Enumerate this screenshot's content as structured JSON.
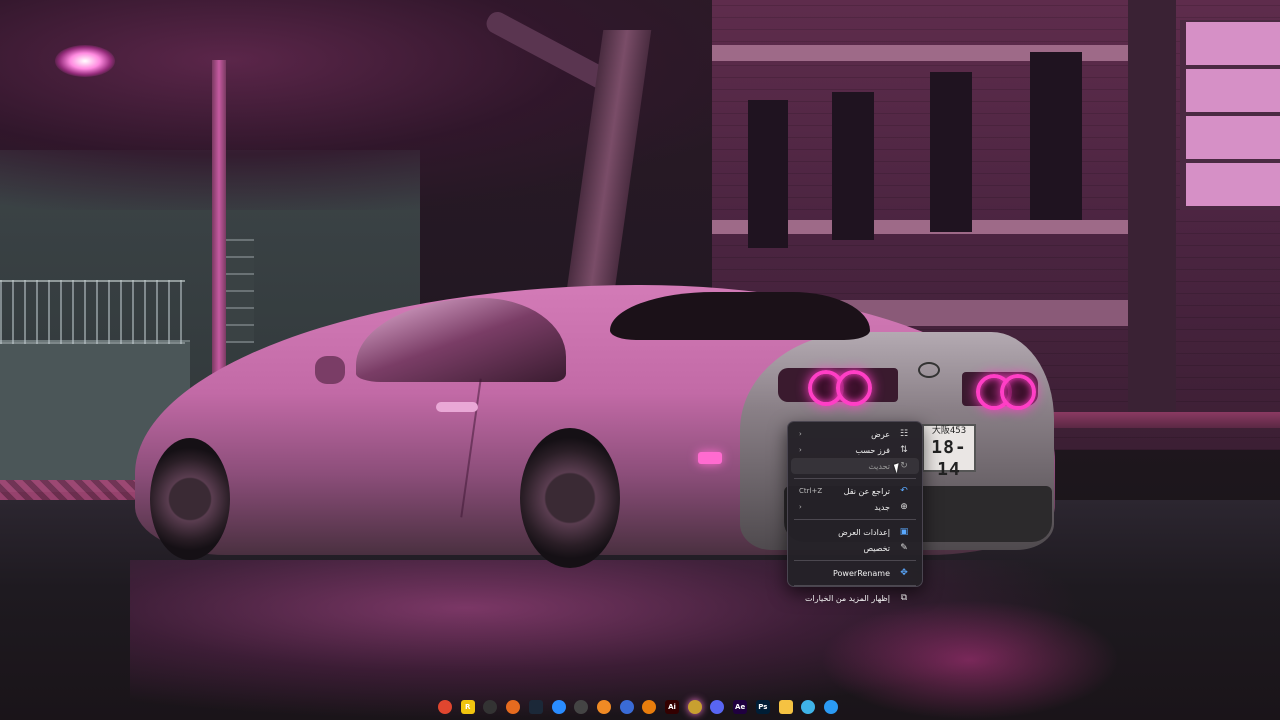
{
  "context_menu": {
    "items": [
      {
        "label": "عرض",
        "icon": "grid-icon",
        "submenu": true,
        "enabled": true
      },
      {
        "label": "فرز حسب",
        "icon": "sort-icon",
        "submenu": true,
        "enabled": true
      },
      {
        "label": "تحديث",
        "icon": "refresh-icon",
        "submenu": false,
        "enabled": false
      },
      {
        "label": "تراجع عن نقل",
        "icon": "undo-icon",
        "shortcut": "Ctrl+Z",
        "enabled": true
      },
      {
        "label": "جديد",
        "icon": "plus-circle-icon",
        "submenu": true,
        "enabled": true
      },
      {
        "label": "إعدادات العرض",
        "icon": "display-icon",
        "enabled": true
      },
      {
        "label": "تخصيص",
        "icon": "brush-icon",
        "enabled": true
      },
      {
        "label": "PowerRename",
        "icon": "powerrename-icon",
        "enabled": true
      },
      {
        "label": "إظهار المزيد من الخيارات",
        "icon": "open-external-icon",
        "enabled": true
      }
    ]
  },
  "wallpaper": {
    "plate_top": "大阪453",
    "plate_bottom": "18-14"
  },
  "taskbar": {
    "icons": [
      {
        "name": "chrome-icon",
        "color": "#e0462f"
      },
      {
        "name": "app-yellow-icon",
        "color": "#f1c40f",
        "text": "R"
      },
      {
        "name": "obs-icon",
        "color": "#333333"
      },
      {
        "name": "firefox-icon",
        "color": "#e56b1f"
      },
      {
        "name": "steam-icon",
        "color": "#1b2838"
      },
      {
        "name": "play-icon",
        "color": "#2a8cff"
      },
      {
        "name": "speedometer-icon",
        "color": "#444444"
      },
      {
        "name": "vlc-icon",
        "color": "#f08a24"
      },
      {
        "name": "circle-app-icon",
        "color": "#3a6bd6"
      },
      {
        "name": "blender-icon",
        "color": "#e87d0d"
      },
      {
        "name": "illustrator-icon",
        "color": "#330000",
        "text": "Ai"
      },
      {
        "name": "active-app-icon",
        "color": "#c8a030"
      },
      {
        "name": "discord-icon",
        "color": "#5865f2"
      },
      {
        "name": "after-effects-icon",
        "color": "#1f0040",
        "text": "Ae"
      },
      {
        "name": "photoshop-icon",
        "color": "#001e36",
        "text": "Ps"
      },
      {
        "name": "file-explorer-icon",
        "color": "#f5c242"
      },
      {
        "name": "copilot-icon",
        "color": "#3fb3e8"
      },
      {
        "name": "windows-start-icon",
        "color": "#2b9af3"
      }
    ]
  }
}
